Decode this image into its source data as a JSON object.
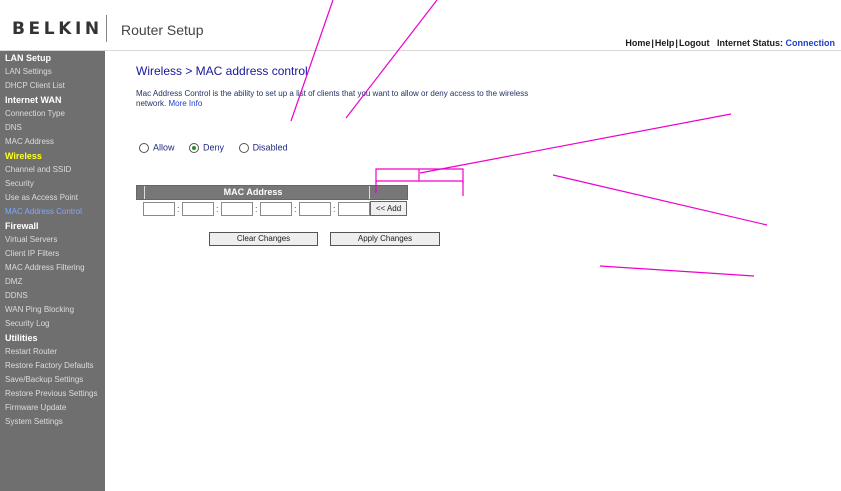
{
  "header": {
    "brand": "BELKIN",
    "title": "Router Setup",
    "links": [
      "Home",
      "Help",
      "Logout"
    ],
    "internet_status_label": "Internet Status:",
    "internet_status_value": "Connection"
  },
  "sidebar": {
    "sections": [
      {
        "label": "LAN Setup",
        "items": [
          "LAN Settings",
          "DHCP Client List"
        ]
      },
      {
        "label": "Internet WAN",
        "items": [
          "Connection Type",
          "DNS",
          "MAC Address"
        ]
      },
      {
        "label": "Wireless",
        "items": [
          "Channel and SSID",
          "Security",
          "Use as Access Point",
          "MAC Address Control"
        ]
      },
      {
        "label": "Firewall",
        "items": [
          "Virtual Servers",
          "Client IP Filters",
          "MAC Address Filtering",
          "DMZ",
          "DDNS",
          "WAN Ping Blocking",
          "Security Log"
        ]
      },
      {
        "label": "Utilities",
        "items": [
          "Restart Router",
          "Restore Factory Defaults",
          "Save/Backup Settings",
          "Restore Previous Settings",
          "Firmware Update",
          "System Settings"
        ]
      }
    ],
    "active_section": "Wireless",
    "current_item": "MAC Address Control"
  },
  "main": {
    "title": "Wireless > MAC address control",
    "description": "Mac Address Control is the ability to set up a list of clients that you want to allow or deny access to the wireless network.",
    "more_info": "More Info",
    "mode_options": [
      "Allow",
      "Deny",
      "Disabled"
    ],
    "selected_mode": "Deny",
    "table_header": "MAC Address",
    "mac_octets": [
      "",
      "",
      "",
      "",
      "",
      ""
    ],
    "add_button": "<< Add",
    "clear_button": "Clear Changes",
    "apply_button": "Apply Changes"
  },
  "colors": {
    "sidebar_bg": "#6f6f6f",
    "active_section": "#ffff22",
    "current_item": "#7fa8ff",
    "title_blue": "#17169a",
    "annotation": "#ee00cc"
  }
}
